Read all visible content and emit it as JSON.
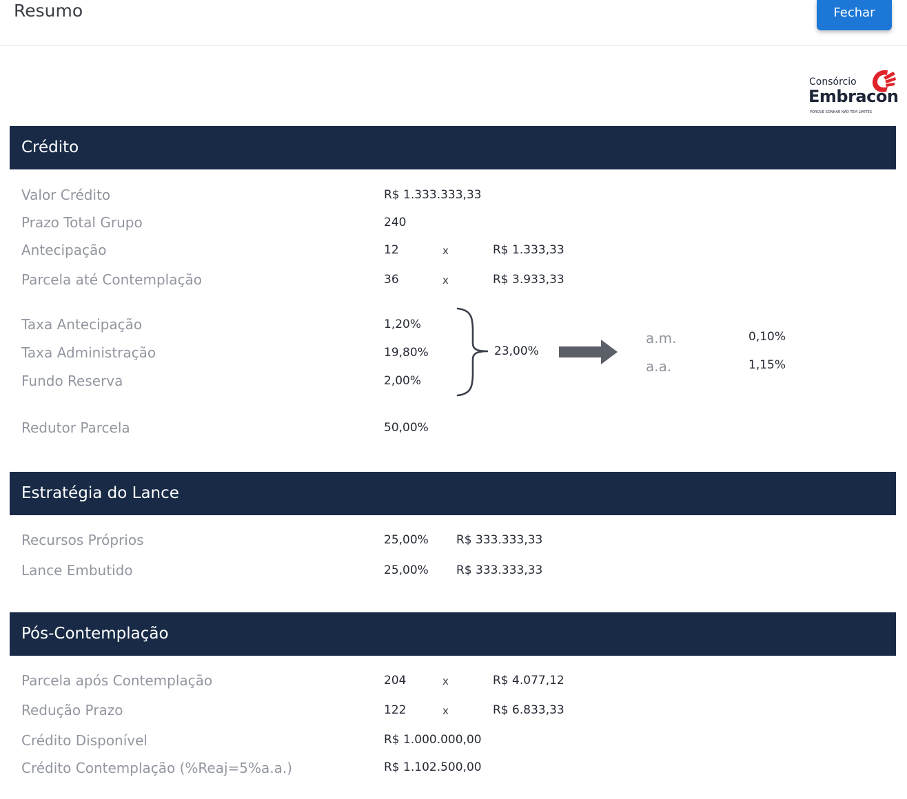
{
  "header": {
    "title": "Resumo",
    "close_label": "Fechar"
  },
  "logo": {
    "line1": "Consórcio",
    "line2": "Embracon",
    "tagline": "PORQUE SONHAR NÃO TEM LIMITES"
  },
  "credito": {
    "section_title": "Crédito",
    "valor_credito": {
      "label": "Valor Crédito",
      "value": "R$ 1.333.333,33"
    },
    "prazo_total": {
      "label": "Prazo Total Grupo",
      "value": "240"
    },
    "antecipacao": {
      "label": "Antecipação",
      "qty": "12",
      "times": "x",
      "amount": "R$ 1.333,33"
    },
    "parcela_ate": {
      "label": "Parcela até Contemplação",
      "qty": "36",
      "times": "x",
      "amount": "R$ 3.933,33"
    },
    "taxa_antecipacao": {
      "label": "Taxa Antecipação",
      "value": "1,20%"
    },
    "taxa_administracao": {
      "label": "Taxa Administração",
      "value": "19,80%"
    },
    "fundo_reserva": {
      "label": "Fundo Reserva",
      "value": "2,00%"
    },
    "taxa_total": "23,00%",
    "am": {
      "label": "a.m.",
      "value": "0,10%"
    },
    "aa": {
      "label": "a.a.",
      "value": "1,15%"
    },
    "redutor": {
      "label": "Redutor Parcela",
      "value": "50,00%"
    }
  },
  "estrategia": {
    "section_title": "Estratégia do Lance",
    "recursos": {
      "label": "Recursos Próprios",
      "pct": "25,00%",
      "amount": "R$ 333.333,33"
    },
    "embutido": {
      "label": "Lance Embutido",
      "pct": "25,00%",
      "amount": "R$ 333.333,33"
    }
  },
  "pos": {
    "section_title": "Pós-Contemplação",
    "parcela_apos": {
      "label": "Parcela após Contemplação",
      "qty": "204",
      "times": "x",
      "amount": "R$ 4.077,12"
    },
    "reducao_prazo": {
      "label": "Redução Prazo",
      "qty": "122",
      "times": "x",
      "amount": "R$ 6.833,33"
    },
    "credito_disponivel": {
      "label": "Crédito Disponível",
      "value": "R$ 1.000.000,00"
    },
    "credito_contemplacao": {
      "label": "Crédito Contemplação (%Reaj=5%a.a.)",
      "value": "R$ 1.102.500,00"
    }
  },
  "colors": {
    "band": "#182a45",
    "button": "#1d77d6",
    "logo_red": "#e0232a"
  }
}
